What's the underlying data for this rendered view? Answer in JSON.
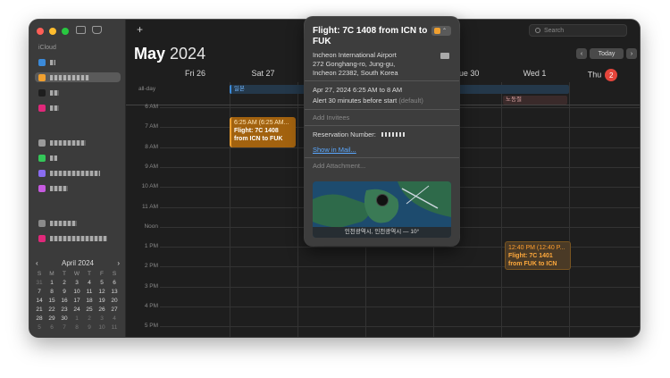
{
  "sidebar": {
    "section1": "iCloud",
    "calendars1": [
      {
        "color": "#3b8ad9",
        "w": 6
      },
      {
        "color": "#f0a030",
        "w": 44,
        "selected": true
      },
      {
        "color": "#1e1e1e",
        "w": 10
      },
      {
        "color": "#e0287a",
        "w": 10
      }
    ],
    "calendars2": [
      {
        "color": "#9a9a9a",
        "w": 40
      },
      {
        "color": "#34c759",
        "w": 8
      },
      {
        "color": "#8a6cf0",
        "w": 56
      },
      {
        "color": "#c65ae0",
        "w": 20
      }
    ],
    "calendars3": [
      {
        "color": "#8a8a8a",
        "w": 30
      },
      {
        "color": "#e0287a",
        "w": 64
      }
    ]
  },
  "mini_calendar": {
    "title": "April 2024",
    "prev": "‹",
    "next": "›",
    "weekdays": [
      "S",
      "M",
      "T",
      "W",
      "T",
      "F",
      "S"
    ],
    "days": [
      [
        "31",
        "1",
        "2",
        "3",
        "4",
        "5",
        "6"
      ],
      [
        "7",
        "8",
        "9",
        "10",
        "11",
        "12",
        "13"
      ],
      [
        "14",
        "15",
        "16",
        "17",
        "18",
        "19",
        "20"
      ],
      [
        "21",
        "22",
        "23",
        "24",
        "25",
        "26",
        "27"
      ],
      [
        "28",
        "29",
        "30",
        "1",
        "2",
        "3",
        "4"
      ],
      [
        "5",
        "6",
        "7",
        "8",
        "9",
        "10",
        "11"
      ]
    ]
  },
  "toolbar": {
    "add": "+",
    "search_placeholder": "Search",
    "today": "Today",
    "prev": "‹",
    "next": "›"
  },
  "header": {
    "month": "May",
    "year": "2024",
    "days": [
      "Fri 26",
      "Sat 27",
      "",
      "",
      "Tue 30",
      "Wed 1",
      "Thu"
    ],
    "today_num": "2"
  },
  "allday": {
    "label": "all-day",
    "event1": "일본",
    "event2": "노동절"
  },
  "hours": [
    "6 AM",
    "7 AM",
    "8 AM",
    "9 AM",
    "10 AM",
    "11 AM",
    "Noon",
    "1 PM",
    "2 PM",
    "3 PM",
    "4 PM",
    "5 PM"
  ],
  "events": {
    "e1_time": "6:25 AM (6:25 AM...",
    "e1_title": "Flight: 7C 1408",
    "e1_sub": "from ICN to FUK",
    "e2_time": "12:40 PM (12:40 P...",
    "e2_title": "Flight: 7C 1401",
    "e2_sub": "from FUK to ICN"
  },
  "popover": {
    "title": "Flight: 7C 1408 from ICN to FUK",
    "location_name": "Incheon International Airport",
    "location_addr1": "272 Gonghang-ro, Jung-gu,",
    "location_addr2": "Incheon 22382, South Korea",
    "date": "Apr 27, 2024  6:25 AM to 8 AM",
    "alert": "Alert 30 minutes before start",
    "alert_default": "(default)",
    "invitees": "Add Invitees",
    "reservation_label": "Reservation Number:",
    "show_in_mail": "Show in Mail...",
    "attachment": "Add Attachment...",
    "map_caption": "인천광역시, 인천광역시 — 10°"
  }
}
